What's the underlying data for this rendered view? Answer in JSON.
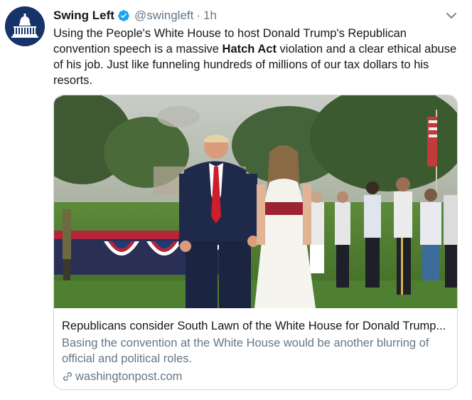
{
  "tweet": {
    "author_name": "Swing Left",
    "handle": "@swingleft",
    "separator": "·",
    "time": "1h",
    "text_part1": "Using the People's White House to host Donald Trump's Republican convention speech is a massive ",
    "text_bold": "Hatch Act",
    "text_part2": " violation and a clear ethical abuse of his job. Just like funneling hundreds of millions of our tax dollars to his resorts."
  },
  "card": {
    "title": "Republicans consider South Lawn of the White House for Donald Trump...",
    "description": "Basing the convention at the White House would be another blurring of official and political roles.",
    "domain": "washingtonpost.com"
  },
  "icons": {
    "verified": "verified-badge-icon",
    "caret": "chevron-down-icon",
    "link": "link-icon"
  },
  "colors": {
    "text": "#14171a",
    "secondary": "#657786",
    "verified": "#1da1f2",
    "border": "#ccd6dd",
    "avatar_bg": "#16346a"
  }
}
